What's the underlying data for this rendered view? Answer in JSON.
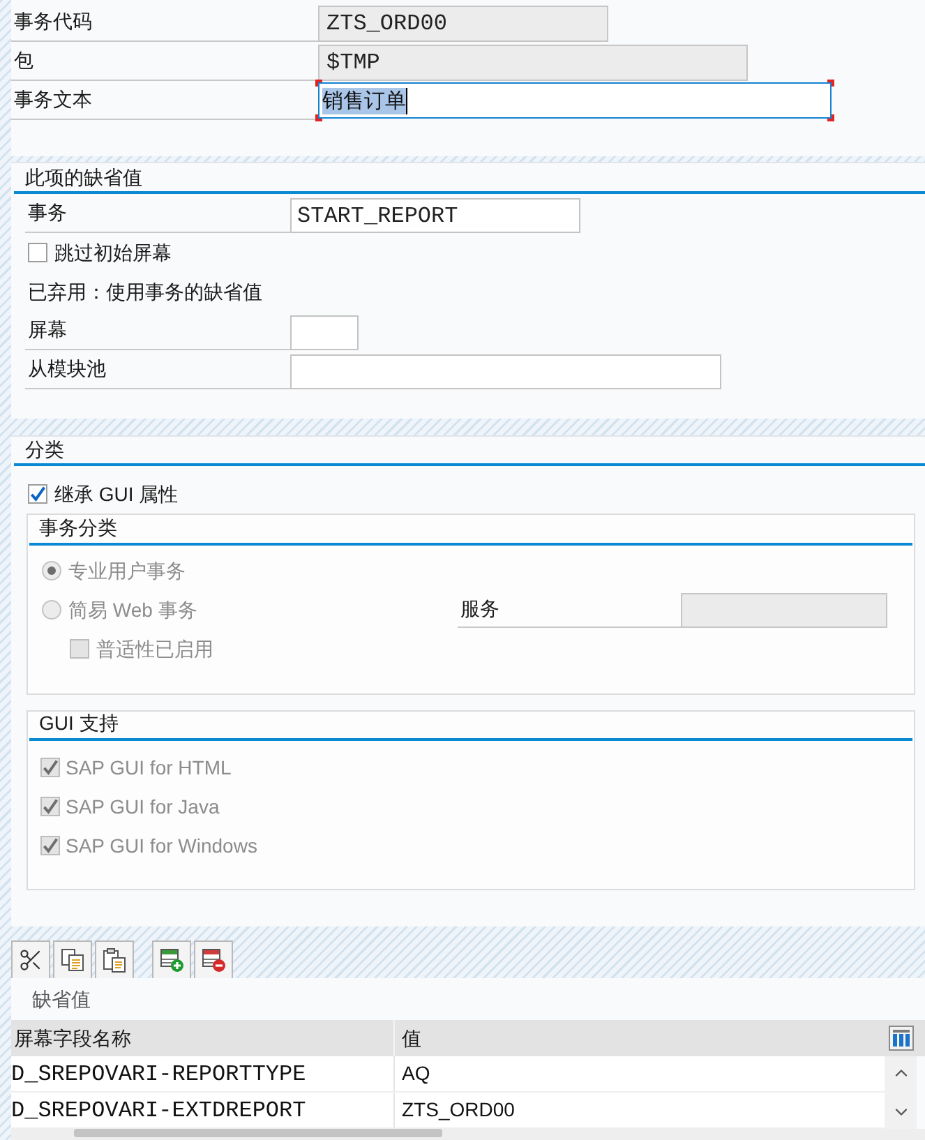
{
  "header_fields": [
    {
      "label": "事务代码",
      "value": "ZTS_ORD00",
      "kind": "display"
    },
    {
      "label": "包",
      "value": "$TMP",
      "kind": "display"
    },
    {
      "label": "事务文本",
      "value": "销售订单",
      "kind": "focused"
    }
  ],
  "defaults": {
    "title": "此项的缺省值",
    "transaction": {
      "label": "事务",
      "value": "START_REPORT"
    },
    "skip_initial_screen": {
      "label": "跳过初始屏幕",
      "checked": false
    },
    "note": "已弃用：使用事务的缺省值",
    "screen": {
      "label": "屏幕"
    },
    "module_pool": {
      "label": "从模块池"
    }
  },
  "classification": {
    "title": "分类",
    "inherit_gui": {
      "label": "继承 GUI 属性",
      "checked": true
    },
    "transaction_class": {
      "title": "事务分类",
      "options": [
        {
          "label": "专业用户事务",
          "selected": true,
          "disabled": true
        },
        {
          "label": "简易 Web 事务",
          "selected": false,
          "disabled": true
        }
      ],
      "service": {
        "label": "服务",
        "disabled": true
      },
      "pervasive": {
        "label": "普适性已启用",
        "checked": false,
        "disabled": true
      }
    },
    "gui_support": {
      "title": "GUI 支持",
      "items": [
        {
          "label": "SAP GUI for HTML",
          "checked": true,
          "disabled": true
        },
        {
          "label": "SAP GUI for Java",
          "checked": true,
          "disabled": true
        },
        {
          "label": "SAP GUI for Windows",
          "checked": true,
          "disabled": true
        }
      ]
    }
  },
  "defaults_table": {
    "title": "缺省值",
    "columns": [
      "屏幕字段名称",
      "值"
    ],
    "rows": [
      [
        "D_SREPOVARI-REPORTTYPE",
        "AQ"
      ],
      [
        "D_SREPOVARI-EXTDREPORT",
        "ZTS_ORD00"
      ]
    ]
  }
}
